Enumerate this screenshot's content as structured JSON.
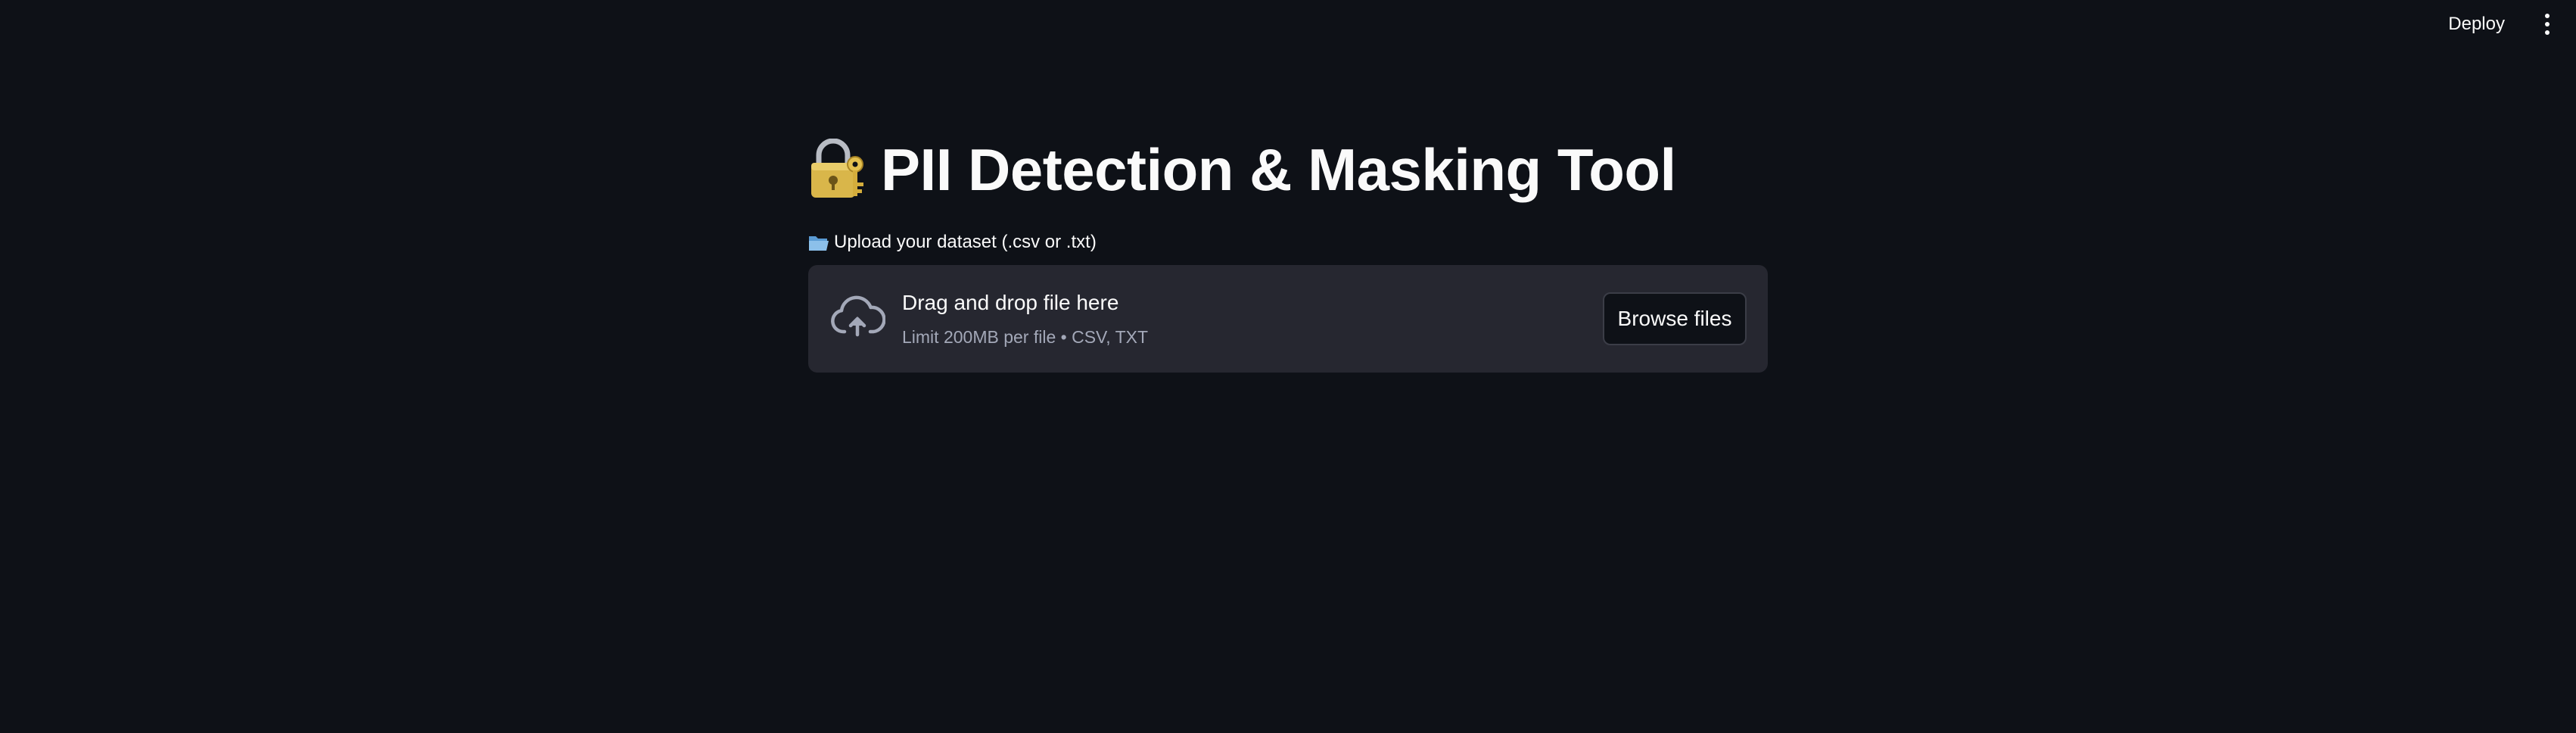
{
  "header": {
    "deploy_label": "Deploy",
    "menu_icon": "kebab-menu-icon"
  },
  "main": {
    "title": "PII Detection & Masking Tool",
    "title_icon": "lock-with-key-icon",
    "upload": {
      "label_icon": "open-folder-icon",
      "label": "Upload your dataset (.csv or .txt)",
      "dropzone_icon": "cloud-upload-icon",
      "dropzone_title": "Drag and drop file here",
      "dropzone_subtitle": "Limit 200MB per file • CSV, TXT",
      "browse_label": "Browse files"
    }
  },
  "colors": {
    "background": "#0e1117",
    "dropzone_bg": "#262730",
    "text": "#fafafa",
    "muted_text": "#a3a8b8"
  }
}
